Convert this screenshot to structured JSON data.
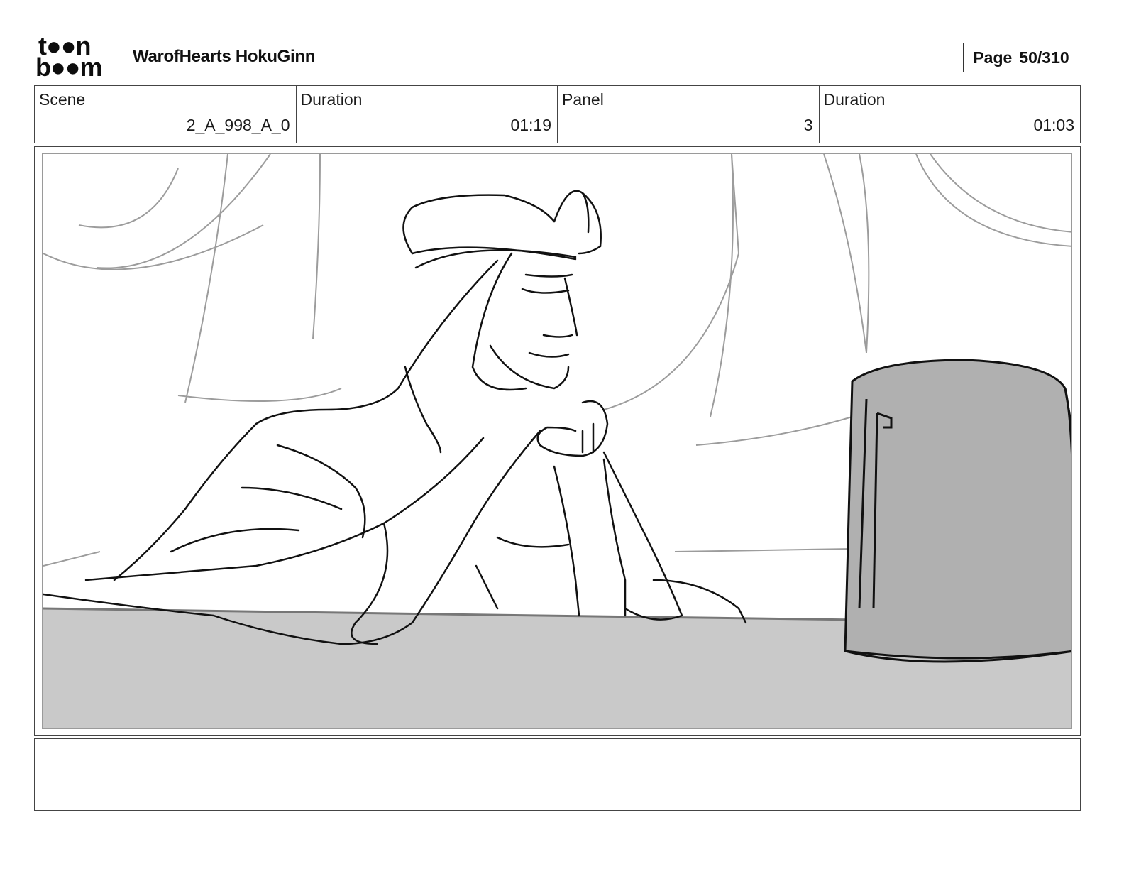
{
  "header": {
    "logo_line1": "t●●n",
    "logo_line2": "b●●m",
    "project_title": "WarofHearts HokuGinn",
    "page_label": "Page",
    "page_number": "50/310"
  },
  "info": {
    "scene_label": "Scene",
    "scene_value": "2_A_998_A_0",
    "scene_duration_label": "Duration",
    "scene_duration_value": "01:19",
    "panel_label": "Panel",
    "panel_value": "3",
    "panel_duration_label": "Duration",
    "panel_duration_value": "01:03"
  },
  "colors": {
    "table_gray": "#c9c9c9",
    "object_gray": "#b0b0b0",
    "line_dark": "#111111",
    "line_light": "#9c9c9c"
  }
}
